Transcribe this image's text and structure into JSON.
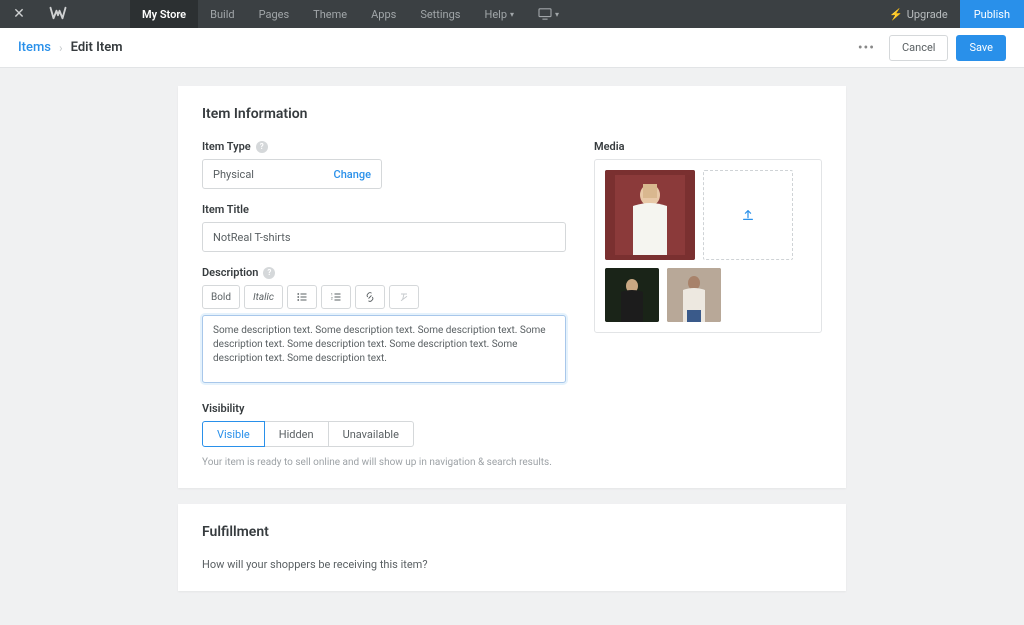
{
  "topbar": {
    "items": [
      "My Store",
      "Build",
      "Pages",
      "Theme",
      "Apps",
      "Settings",
      "Help"
    ],
    "upgrade": "Upgrade",
    "publish": "Publish"
  },
  "subbar": {
    "crumb_link": "Items",
    "crumb_current": "Edit Item",
    "cancel": "Cancel",
    "save": "Save"
  },
  "item_info": {
    "heading": "Item Information",
    "type_label": "Item Type",
    "type_value": "Physical",
    "change": "Change",
    "title_label": "Item Title",
    "title_value": "NotReal T-shirts",
    "desc_label": "Description",
    "toolbar": {
      "bold": "Bold",
      "italic": "Italic"
    },
    "desc_value": "Some description text. Some description text. Some description text. Some description text. Some description text. Some description text. Some description text. Some description text.",
    "visibility_label": "Visibility",
    "visibility_options": [
      "Visible",
      "Hidden",
      "Unavailable"
    ],
    "visibility_hint": "Your item is ready to sell online and will show up in navigation & search results.",
    "media_label": "Media"
  },
  "fulfillment": {
    "heading": "Fulfillment",
    "question": "How will your shoppers be receiving this item?"
  }
}
